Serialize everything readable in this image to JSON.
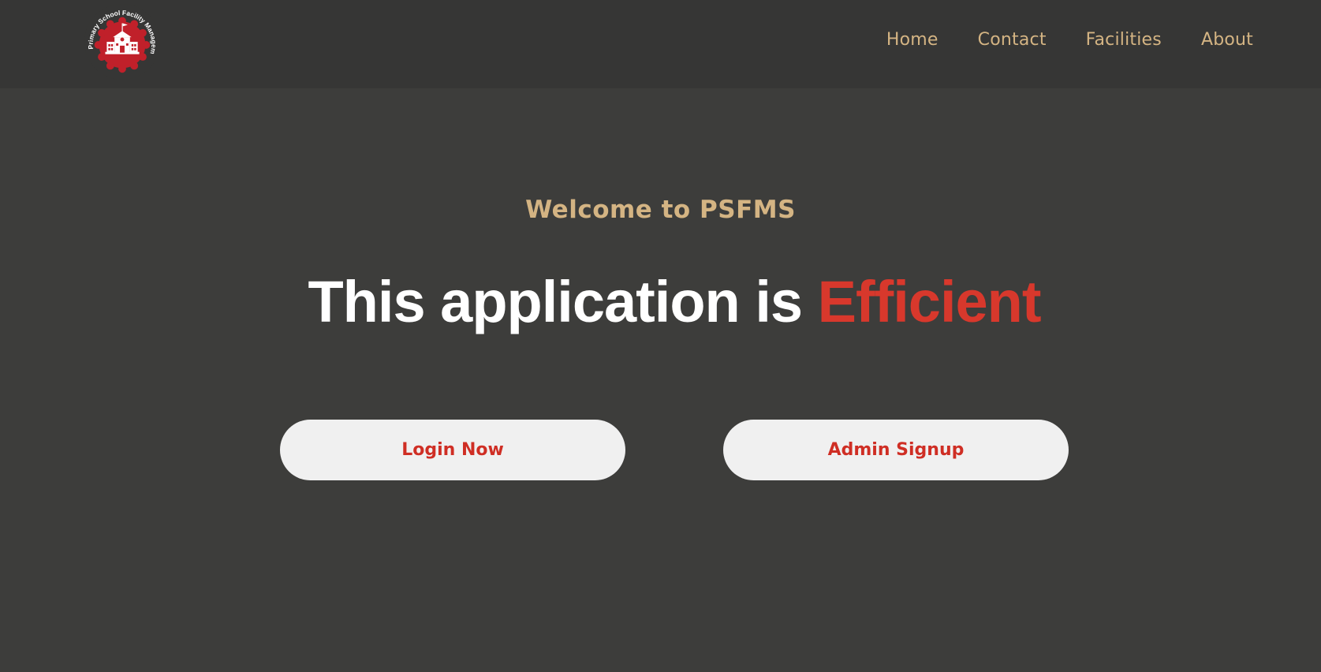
{
  "brand": {
    "logo_ring_text": "Primary School Facility Management System",
    "logo_color": "#c0202a"
  },
  "nav": {
    "items": [
      {
        "label": "Home"
      },
      {
        "label": "Contact"
      },
      {
        "label": "Facilities"
      },
      {
        "label": "About"
      }
    ],
    "color": "#d4b483"
  },
  "hero": {
    "welcome": "Welcome to PSFMS",
    "headline_prefix": "This application is ",
    "headline_accent": "Efficient",
    "accent_color": "#d8382c"
  },
  "buttons": {
    "login_label": "Login Now",
    "signup_label": "Admin Signup",
    "text_color": "#cf2e24"
  },
  "colors": {
    "navbar_bg": "#363635",
    "page_bg": "#3d3d3b"
  }
}
